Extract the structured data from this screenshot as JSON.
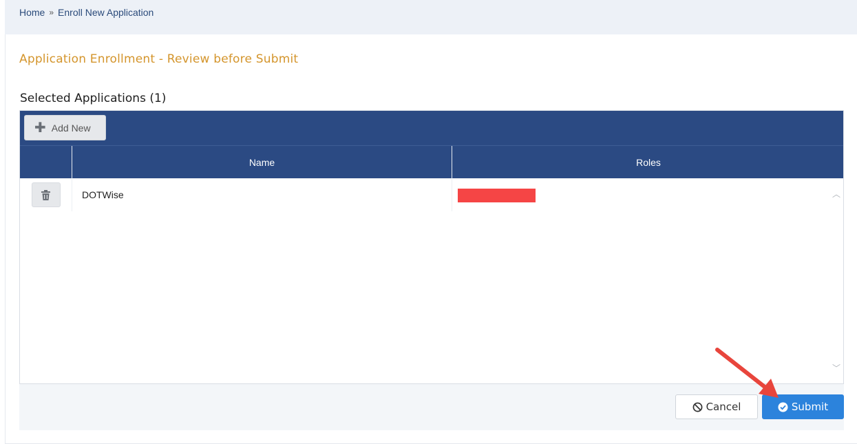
{
  "breadcrumb": {
    "home": "Home",
    "separator": "»",
    "current": "Enroll New Application"
  },
  "page": {
    "title": "Application Enrollment - Review before Submit",
    "section_title": "Selected Applications (1)"
  },
  "grid": {
    "toolbar": {
      "add_new_label": "Add New",
      "add_icon": "plus-icon"
    },
    "columns": [
      "",
      "Name",
      "Roles"
    ],
    "rows": [
      {
        "name": "DOTWise",
        "roles_redacted": true,
        "delete_icon": "trash-icon"
      }
    ]
  },
  "footer": {
    "cancel_label": "Cancel",
    "cancel_icon": "ban-icon",
    "submit_label": "Submit",
    "submit_icon": "check-circle-icon"
  },
  "colors": {
    "accent_title": "#d4952c",
    "header_bg": "#2b4a83",
    "submit_bg": "#2c83dc",
    "redaction": "#f54545",
    "annotation_arrow": "#e8453c"
  }
}
